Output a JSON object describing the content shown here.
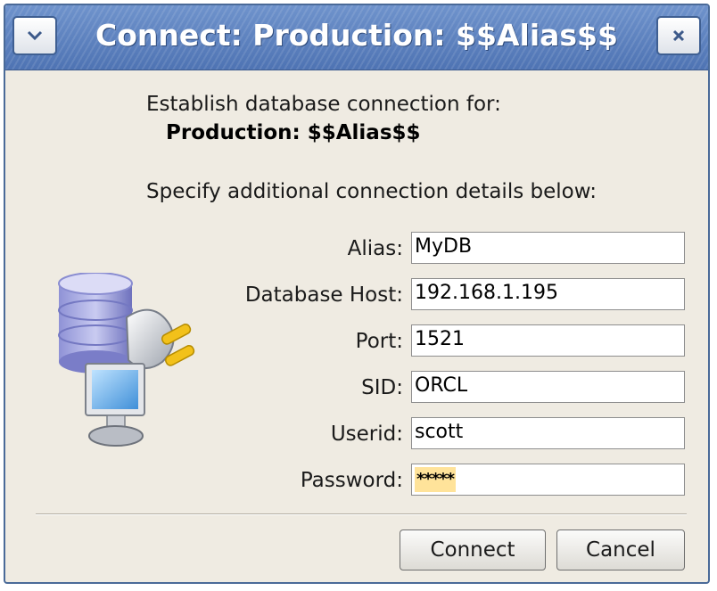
{
  "window": {
    "title": "Connect: Production: $$Alias$$",
    "menu_button_icon": "chevron-down-icon",
    "close_button_icon": "close-icon"
  },
  "intro": {
    "line1": "Establish database connection for:",
    "connection_name": "Production: $$Alias$$",
    "line2": "Specify additional connection details below:"
  },
  "form": {
    "alias": {
      "label": "Alias:",
      "value": "MyDB"
    },
    "host": {
      "label": "Database Host:",
      "value": "192.168.1.195"
    },
    "port": {
      "label": "Port:",
      "value": "1521"
    },
    "sid": {
      "label": "SID:",
      "value": "ORCL"
    },
    "userid": {
      "label": "Userid:",
      "value": "scott"
    },
    "password": {
      "label": "Password:",
      "value": "*****"
    }
  },
  "buttons": {
    "connect": "Connect",
    "cancel": "Cancel"
  },
  "icon": {
    "name": "database-connection-icon"
  },
  "colors": {
    "titlebar": "#5a7fbe",
    "background": "#efebe2",
    "password_highlight": "#ffe39a"
  }
}
